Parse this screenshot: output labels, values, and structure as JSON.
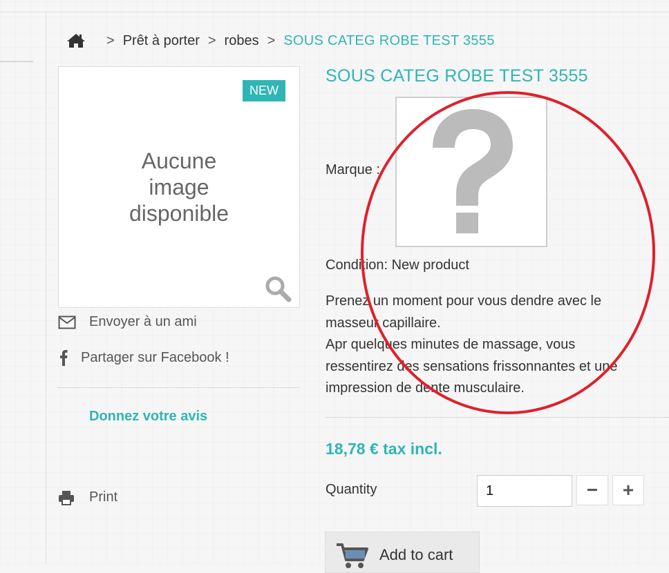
{
  "breadcrumb": {
    "home_icon": "home-icon",
    "separator": ">",
    "items": [
      "Prêt à porter",
      "robes",
      "SOUS CATEG ROBE TEST 3555"
    ]
  },
  "product": {
    "badge": "NEW",
    "no_image_lines": [
      "Aucune",
      "image",
      "disponible"
    ],
    "title": "SOUS CATEG ROBE TEST 3555",
    "brand_label": "Marque :",
    "condition": "Condition: New product",
    "description_lines": [
      "Prenez un moment pour vous dendre avec le",
      "masseur capillaire.",
      "Apr quelques minutes de massage, vous",
      "ressentirez des sensations frissonnantes et une",
      "impression de dente musculaire."
    ],
    "price": "18,78 € tax incl.",
    "quantity_label": "Quantity",
    "quantity_value": "1",
    "minus_label": "−",
    "plus_label": "+",
    "add_to_cart": "Add to cart"
  },
  "actions": {
    "email_friend": "Envoyer à un ami",
    "share_facebook": "Partager sur Facebook !",
    "review": "Donnez votre avis",
    "print": "Print"
  },
  "colors": {
    "accent": "#2fb5b5",
    "annotation": "#e0202b"
  }
}
